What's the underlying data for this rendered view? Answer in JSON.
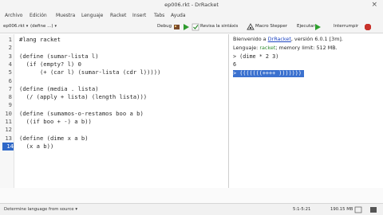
{
  "window": {
    "title": "ep006.rkt - DrRacket",
    "close_glyph": "×"
  },
  "menu": [
    "Archivo",
    "Edición",
    "Muestra",
    "Lenguaje",
    "Racket",
    "Insert",
    "Tabs",
    "Ayuda"
  ],
  "toolbar": {
    "file_combo": "ep006.rkt",
    "define_combo": "(define ...)",
    "debug": "Debug",
    "check_syntax": "Revisa la sintáxis",
    "macro_stepper": "Macro Stepper",
    "run": "Ejecutar",
    "stop": "Interrumpir"
  },
  "editor": {
    "lines": [
      "#lang racket",
      "",
      "(define (sumar-lista l)",
      "  (if (empty? l) 0",
      "      (+ (car l) (sumar-lista (cdr l)))))",
      "",
      "(define (media . lista)",
      "  (/ (apply + lista) (length lista)))",
      "",
      "(define (sumamos-o-restamos boo a b)",
      "  ((if boo + -) a b))",
      "",
      "(define (dime x a b)",
      "  (x a b))"
    ],
    "current_line": 14
  },
  "repl": {
    "welcome_prefix": "Bienvenido a ",
    "welcome_link": "DrRacket",
    "welcome_suffix": ", versión 6.0.1 [3m].",
    "lang_prefix": "Lenguaje: ",
    "lang_name": "racket",
    "lang_suffix": "; memory limit: 512 MB.",
    "input1": "> (dime * 2 3)",
    "output1": "6",
    "input2_prompt": "> ",
    "input2": "(((((((++++ )))))))"
  },
  "status": {
    "language": "Determine language from source",
    "position": "5:1-5:21",
    "memory": "190.15 MB"
  },
  "colors": {
    "selection": "#3b71cf",
    "current_line": "#2f68c8",
    "link": "#1f46c2",
    "racket_green": "#2e8b2e"
  }
}
